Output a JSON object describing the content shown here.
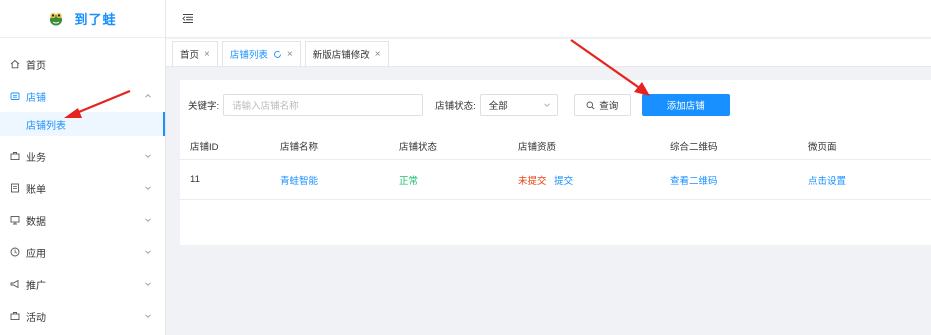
{
  "brand": {
    "name": "到了蛙"
  },
  "sidebar": {
    "items": [
      {
        "label": "首页",
        "icon": "home-icon",
        "expandable": false
      },
      {
        "label": "店铺",
        "icon": "shop-icon",
        "expandable": true,
        "expanded": true,
        "active": true,
        "children": [
          {
            "label": "店铺列表",
            "active": true
          }
        ]
      },
      {
        "label": "业务",
        "icon": "business-icon",
        "expandable": true
      },
      {
        "label": "账单",
        "icon": "bill-icon",
        "expandable": true
      },
      {
        "label": "数据",
        "icon": "data-icon",
        "expandable": true
      },
      {
        "label": "应用",
        "icon": "app-icon",
        "expandable": true
      },
      {
        "label": "推广",
        "icon": "promo-icon",
        "expandable": true
      },
      {
        "label": "活动",
        "icon": "activity-icon",
        "expandable": true
      }
    ]
  },
  "tabs": [
    {
      "label": "首页",
      "active": false,
      "close": "×"
    },
    {
      "label": "店铺列表",
      "active": true,
      "close": "×"
    },
    {
      "label": "新版店铺修改",
      "active": false,
      "close": "×"
    }
  ],
  "filter": {
    "keyword_label": "关键字:",
    "keyword_placeholder": "请输入店铺名称",
    "status_label": "店铺状态:",
    "status_value": "全部",
    "search_label": "查询",
    "add_label": "添加店铺"
  },
  "table": {
    "headers": [
      "店铺ID",
      "店铺名称",
      "店铺状态",
      "店铺资质",
      "综合二维码",
      "微页面"
    ],
    "rows": [
      {
        "id": "11",
        "name": "青蛙智能",
        "status": "正常",
        "qual_state": "未提交",
        "qual_action": "提交",
        "qrcode": "查看二维码",
        "micro_page": "点击设置"
      }
    ]
  },
  "colors": {
    "accent": "#1890ff",
    "success": "#19be6b",
    "danger": "#ed4014",
    "arrow": "#e6231e"
  }
}
